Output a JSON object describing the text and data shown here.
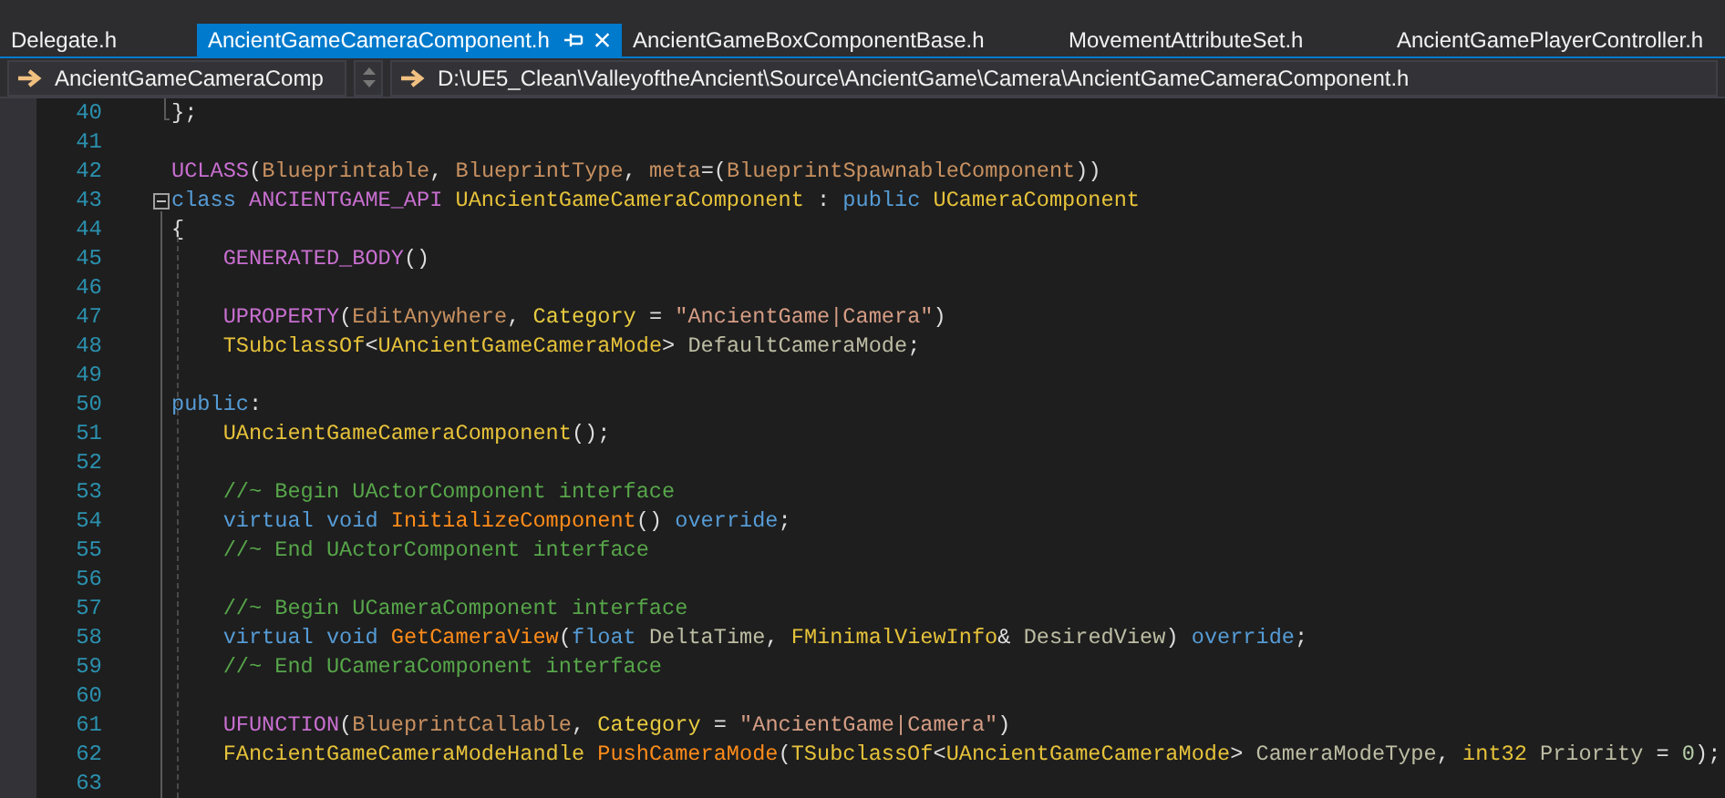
{
  "tabs": [
    {
      "label": "Delegate.h",
      "selected": false
    },
    {
      "label": "AncientGameCameraComponent.h",
      "selected": true,
      "pinned": true
    },
    {
      "label": "AncientGameBoxComponentBase.h",
      "selected": false
    },
    {
      "label": "MovementAttributeSet.h",
      "selected": false
    },
    {
      "label": "AncientGamePlayerController.h",
      "selected": false
    }
  ],
  "navigation_bar": {
    "scope": "AncientGameCameraComp",
    "path": "D:\\UE5_Clean\\ValleyoftheAncient\\Source\\AncientGame\\Camera\\AncientGameCameraComponent.h"
  },
  "editor_lines": [
    {
      "number": "40",
      "tokens": [
        {
          "kind": "plain",
          "text": "};"
        }
      ]
    },
    {
      "number": "41"
    },
    {
      "number": "42",
      "tokens": [
        {
          "kind": "macro",
          "text": "UCLASS"
        },
        {
          "kind": "plain",
          "text": "("
        },
        {
          "kind": "arg",
          "text": "Blueprintable"
        },
        {
          "kind": "plain",
          "text": ", "
        },
        {
          "kind": "arg",
          "text": "BlueprintType"
        },
        {
          "kind": "plain",
          "text": ", "
        },
        {
          "kind": "arg",
          "text": "meta"
        },
        {
          "kind": "plain",
          "text": "=("
        },
        {
          "kind": "arg",
          "text": "BlueprintSpawnableComponent"
        },
        {
          "kind": "plain",
          "text": "))"
        }
      ]
    },
    {
      "number": "43",
      "fold": {
        "expanded": true
      },
      "tokens": [
        {
          "kind": "keyword",
          "text": "class "
        },
        {
          "kind": "macro",
          "text": "ANCIENTGAME_API "
        },
        {
          "kind": "type",
          "text": "UAncientGameCameraComponent"
        },
        {
          "kind": "plain",
          "text": " : "
        },
        {
          "kind": "keyword",
          "text": "public "
        },
        {
          "kind": "type",
          "text": "UCameraComponent"
        }
      ]
    },
    {
      "number": "44",
      "tokens": [
        {
          "kind": "plain",
          "text": "{"
        }
      ]
    },
    {
      "number": "45",
      "tokens": [
        {
          "kind": "macro",
          "text": "    GENERATED_BODY"
        },
        {
          "kind": "plain",
          "text": "()"
        }
      ]
    },
    {
      "number": "46"
    },
    {
      "number": "47",
      "tokens": [
        {
          "kind": "macro",
          "text": "    UPROPERTY"
        },
        {
          "kind": "plain",
          "text": "("
        },
        {
          "kind": "arg",
          "text": "EditAnywhere"
        },
        {
          "kind": "plain",
          "text": ", "
        },
        {
          "kind": "specifier",
          "text": "Category"
        },
        {
          "kind": "plain",
          "text": " = "
        },
        {
          "kind": "string",
          "text": "\"AncientGame|Camera\""
        },
        {
          "kind": "plain",
          "text": ")"
        }
      ]
    },
    {
      "number": "48",
      "tokens": [
        {
          "kind": "type",
          "text": "    TSubclassOf"
        },
        {
          "kind": "plain",
          "text": "<"
        },
        {
          "kind": "type",
          "text": "UAncientGameCameraMode"
        },
        {
          "kind": "plain",
          "text": "> "
        },
        {
          "kind": "param",
          "text": "DefaultCameraMode"
        },
        {
          "kind": "plain",
          "text": ";"
        }
      ]
    },
    {
      "number": "49"
    },
    {
      "number": "50",
      "tokens": [
        {
          "kind": "keyword",
          "text": "public"
        },
        {
          "kind": "plain",
          "text": ":"
        }
      ]
    },
    {
      "number": "51",
      "tokens": [
        {
          "kind": "type",
          "text": "    UAncientGameCameraComponent"
        },
        {
          "kind": "plain",
          "text": "();"
        }
      ]
    },
    {
      "number": "52"
    },
    {
      "number": "53",
      "tokens": [
        {
          "kind": "comment",
          "text": "    //~ Begin UActorComponent interface"
        }
      ]
    },
    {
      "number": "54",
      "tokens": [
        {
          "kind": "keyword",
          "text": "    virtual void "
        },
        {
          "kind": "function",
          "text": "InitializeComponent"
        },
        {
          "kind": "plain",
          "text": "() "
        },
        {
          "kind": "keyword",
          "text": "override"
        },
        {
          "kind": "plain",
          "text": ";"
        }
      ]
    },
    {
      "number": "55",
      "tokens": [
        {
          "kind": "comment",
          "text": "    //~ End UActorComponent interface"
        }
      ]
    },
    {
      "number": "56"
    },
    {
      "number": "57",
      "tokens": [
        {
          "kind": "comment",
          "text": "    //~ Begin UCameraComponent interface"
        }
      ]
    },
    {
      "number": "58",
      "tokens": [
        {
          "kind": "keyword",
          "text": "    virtual void "
        },
        {
          "kind": "function",
          "text": "GetCameraView"
        },
        {
          "kind": "plain",
          "text": "("
        },
        {
          "kind": "keyword",
          "text": "float "
        },
        {
          "kind": "param",
          "text": "DeltaTime"
        },
        {
          "kind": "plain",
          "text": ", "
        },
        {
          "kind": "type",
          "text": "FMinimalViewInfo"
        },
        {
          "kind": "plain",
          "text": "& "
        },
        {
          "kind": "param",
          "text": "DesiredView"
        },
        {
          "kind": "plain",
          "text": ") "
        },
        {
          "kind": "keyword",
          "text": "override"
        },
        {
          "kind": "plain",
          "text": ";"
        }
      ]
    },
    {
      "number": "59",
      "tokens": [
        {
          "kind": "comment",
          "text": "    //~ End UCameraComponent interface"
        }
      ]
    },
    {
      "number": "60"
    },
    {
      "number": "61",
      "tokens": [
        {
          "kind": "macro",
          "text": "    UFUNCTION"
        },
        {
          "kind": "plain",
          "text": "("
        },
        {
          "kind": "arg",
          "text": "BlueprintCallable"
        },
        {
          "kind": "plain",
          "text": ", "
        },
        {
          "kind": "specifier",
          "text": "Category"
        },
        {
          "kind": "plain",
          "text": " = "
        },
        {
          "kind": "string",
          "text": "\"AncientGame|Camera\""
        },
        {
          "kind": "plain",
          "text": ")"
        }
      ]
    },
    {
      "number": "62",
      "tokens": [
        {
          "kind": "type",
          "text": "    FAncientGameCameraModeHandle "
        },
        {
          "kind": "function",
          "text": "PushCameraMode"
        },
        {
          "kind": "plain",
          "text": "("
        },
        {
          "kind": "type",
          "text": "TSubclassOf"
        },
        {
          "kind": "plain",
          "text": "<"
        },
        {
          "kind": "type",
          "text": "UAncientGameCameraMode"
        },
        {
          "kind": "plain",
          "text": "> "
        },
        {
          "kind": "param",
          "text": "CameraModeType"
        },
        {
          "kind": "plain",
          "text": ", "
        },
        {
          "kind": "type",
          "text": "int32 "
        },
        {
          "kind": "param",
          "text": "Priority"
        },
        {
          "kind": "plain",
          "text": " = "
        },
        {
          "kind": "number",
          "text": "0"
        },
        {
          "kind": "plain",
          "text": ");"
        }
      ]
    },
    {
      "number": "63"
    }
  ]
}
